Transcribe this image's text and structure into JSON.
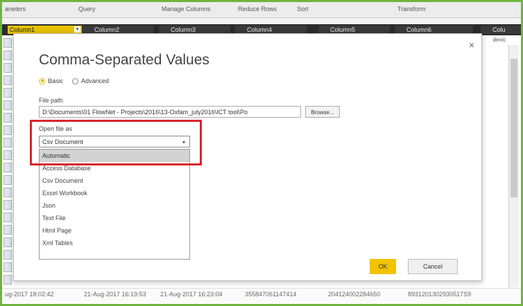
{
  "ribbon": {
    "items": [
      "aneters",
      "Query",
      "Manage Columns",
      "Reduce Rows",
      "Sort",
      "Transform"
    ]
  },
  "columns": [
    "Column1",
    "Column2",
    "Column3",
    "Column4",
    "Column5",
    "Column6",
    "Colu"
  ],
  "grid": {
    "right_col_header": "dexic",
    "bottom_row": [
      "ug-2017 18:02:42",
      "21-Aug-2017 16:19:53",
      "21-Aug-2017 16:23:04",
      "355847061147414",
      "204124002284650",
      "8931201302930517S9"
    ]
  },
  "dialog": {
    "title": "Comma-Separated Values",
    "close_glyph": "×",
    "mode_basic": "Basic",
    "mode_advanced": "Advanced",
    "file_path_label": "File path",
    "file_path_value": "D:\\Documents\\01 FlowNet - Projects\\2016\\13-Oxfam_july2016\\ICT tool\\Po",
    "browse_label": "Browse...",
    "open_file_as_label": "Open file as",
    "open_file_as_value": "Csv Document",
    "options": [
      "Automatic",
      "Access Database",
      "Csv Document",
      "Excel Workbook",
      "Json",
      "Text File",
      "Html Page",
      "Xml Tables"
    ],
    "ok_label": "OK",
    "cancel_label": "Cancel"
  },
  "colors": {
    "accent": "#f2c400",
    "highlight_box": "#d9252b",
    "outer_border": "#6fb43f"
  }
}
